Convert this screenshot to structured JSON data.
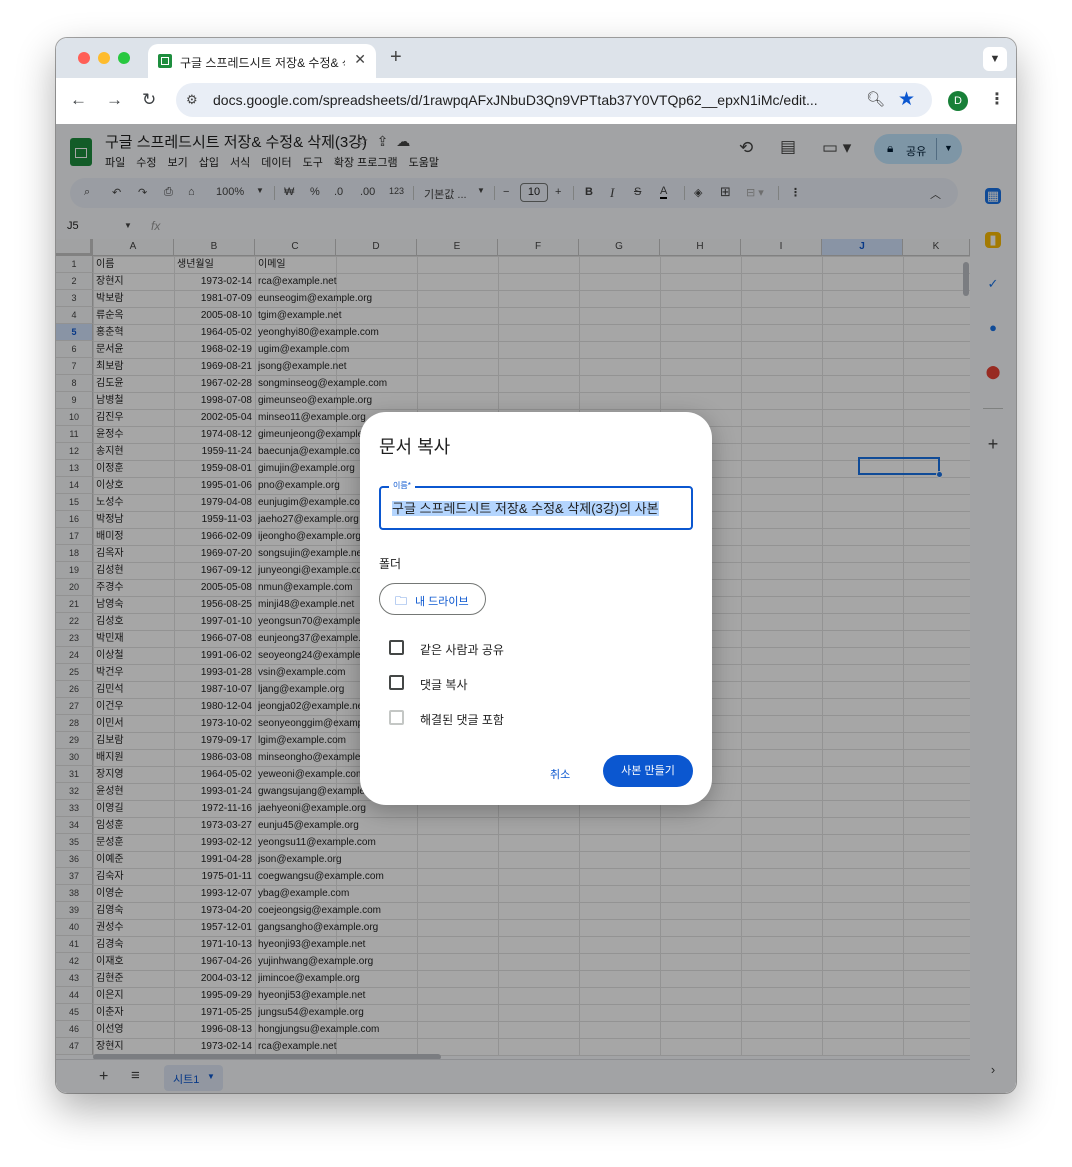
{
  "browser": {
    "tab_title": "구글 스프레드시트 저장& 수정& 삭",
    "url": "docs.google.com/spreadsheets/d/1rawpqAFxJNbuD3Qn9VPTtab37Y0VTQp62__epxN1iMc/edit...",
    "profile_initial": "D"
  },
  "sheet": {
    "doc_title": "구글 스프레드시트 저장& 수정& 삭제(3강)",
    "menus": [
      "파일",
      "수정",
      "보기",
      "삽입",
      "서식",
      "데이터",
      "도구",
      "확장 프로그램",
      "도움말"
    ],
    "share_label": "공유",
    "account_initial": "D",
    "toolbar": {
      "zoom": "100%",
      "currency": "₩",
      "percent": "%",
      "dec_minus": ".0",
      "dec_plus": ".00",
      "number_format": "123",
      "font": "기본값 ...",
      "font_size": "10"
    },
    "namebox": "J5",
    "columns": [
      "A",
      "B",
      "C",
      "D",
      "E",
      "F",
      "G",
      "H",
      "I",
      "J",
      "K"
    ],
    "selected_column": "J",
    "selected_row": 5,
    "header_row": {
      "name": "이름",
      "birth": "생년월일",
      "email": "이메일"
    },
    "rows": [
      [
        "장현지",
        "1973-02-14",
        "rca@example.net"
      ],
      [
        "박보람",
        "1981-07-09",
        "eunseogim@example.org"
      ],
      [
        "류순옥",
        "2005-08-10",
        "tgim@example.net"
      ],
      [
        "홍춘혁",
        "1964-05-02",
        "yeonghyi80@example.com"
      ],
      [
        "문서윤",
        "1968-02-19",
        "ugim@example.com"
      ],
      [
        "최보람",
        "1969-08-21",
        "jsong@example.net"
      ],
      [
        "김도윤",
        "1967-02-28",
        "songminseog@example.com"
      ],
      [
        "남병철",
        "1998-07-08",
        "gimeunseo@example.org"
      ],
      [
        "김진우",
        "2002-05-04",
        "minseo11@example.org"
      ],
      [
        "윤정수",
        "1974-08-12",
        "gimeunjeong@example.org"
      ],
      [
        "송지현",
        "1959-11-24",
        "baecunja@example.com"
      ],
      [
        "이정훈",
        "1959-08-01",
        "gimujin@example.org"
      ],
      [
        "이상호",
        "1995-01-06",
        "pno@example.org"
      ],
      [
        "노성수",
        "1979-04-08",
        "eunjugim@example.com"
      ],
      [
        "박정남",
        "1959-11-03",
        "jaeho27@example.org"
      ],
      [
        "배미정",
        "1966-02-09",
        "ijeongho@example.org"
      ],
      [
        "김옥자",
        "1969-07-20",
        "songsujin@example.net"
      ],
      [
        "김성현",
        "1967-09-12",
        "junyeongi@example.com"
      ],
      [
        "주경수",
        "2005-05-08",
        "nmun@example.com"
      ],
      [
        "남영숙",
        "1956-08-25",
        "minji48@example.net"
      ],
      [
        "김성호",
        "1997-01-10",
        "yeongsun70@example.org"
      ],
      [
        "박민재",
        "1966-07-08",
        "eunjeong37@example.com"
      ],
      [
        "이상철",
        "1991-06-02",
        "seoyeong24@example.org"
      ],
      [
        "박건우",
        "1993-01-28",
        "vsin@example.com"
      ],
      [
        "김민석",
        "1987-10-07",
        "ljang@example.org"
      ],
      [
        "이건우",
        "1980-12-04",
        "jeongja02@example.net"
      ],
      [
        "이민서",
        "1973-10-02",
        "seonyeonggim@example.com"
      ],
      [
        "김보람",
        "1979-09-17",
        "lgim@example.com"
      ],
      [
        "배지원",
        "1986-03-08",
        "minseongho@example.com"
      ],
      [
        "장지영",
        "1964-05-02",
        "yeweoni@example.com"
      ],
      [
        "윤성현",
        "1993-01-24",
        "gwangsujang@example.org"
      ],
      [
        "이영길",
        "1972-11-16",
        "jaehyeoni@example.org"
      ],
      [
        "임성훈",
        "1973-03-27",
        "eunju45@example.org"
      ],
      [
        "문성훈",
        "1993-02-12",
        "yeongsu11@example.com"
      ],
      [
        "이예준",
        "1991-04-28",
        "json@example.org"
      ],
      [
        "김숙자",
        "1975-01-11",
        "coegwangsu@example.com"
      ],
      [
        "이영순",
        "1993-12-07",
        "ybag@example.com"
      ],
      [
        "김영숙",
        "1973-04-20",
        "coejeongsig@example.com"
      ],
      [
        "권성수",
        "1957-12-01",
        "gangsangho@example.org"
      ],
      [
        "김경숙",
        "1971-10-13",
        "hyeonji93@example.net"
      ],
      [
        "이재호",
        "1967-04-26",
        "yujinhwang@example.org"
      ],
      [
        "김현준",
        "2004-03-12",
        "jimincoe@example.org"
      ],
      [
        "이은지",
        "1995-09-29",
        "hyeonji53@example.net"
      ],
      [
        "이춘자",
        "1971-05-25",
        "jungsu54@example.org"
      ],
      [
        "이선영",
        "1996-08-13",
        "hongjungsu@example.com"
      ],
      [
        "장현지",
        "1973-02-14",
        "rca@example.net"
      ]
    ],
    "sheet_tab": "시트1"
  },
  "dialog": {
    "title": "문서 복사",
    "name_label": "이름*",
    "name_value": "구글 스프레드시트 저장& 수정& 삭제(3강)의 사본",
    "folder_label": "폴더",
    "folder_chip": "내 드라이브",
    "options": [
      {
        "label": "같은 사람과 공유",
        "checked": false,
        "disabled": false
      },
      {
        "label": "댓글 복사",
        "checked": false,
        "disabled": false
      },
      {
        "label": "해결된 댓글 포함",
        "checked": false,
        "disabled": true
      }
    ],
    "cancel_label": "취소",
    "confirm_label": "사본 만들기"
  },
  "colors": {
    "accent": "#0b57d0",
    "sheets_green": "#1e8e3e",
    "share_bg": "#c2e7ff",
    "selection": "#1a73e8"
  }
}
